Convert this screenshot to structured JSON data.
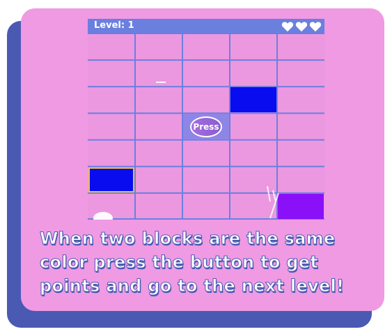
{
  "game": {
    "level_text": "Level: 1",
    "lives": 3,
    "lives_icon": "heart-icon",
    "grid": {
      "rows": 7,
      "cols": 5
    },
    "blocks": [
      {
        "row": 2,
        "col": 3,
        "color": "#0a0cf0",
        "selected": false
      },
      {
        "row": 5,
        "col": 0,
        "color": "#0a0cf0",
        "selected": true
      },
      {
        "row": 6,
        "col": 4,
        "color": "#8a10f8",
        "selected": false
      }
    ],
    "press_button": {
      "label": "Press",
      "row": 3,
      "col": 2,
      "cell_color": "#8e86e6"
    },
    "colors": {
      "board": "#eb98e1",
      "topbar": "#6b7fdf",
      "grid_line": "#6b7fdf",
      "selected_outline": "#f0c040"
    }
  },
  "instructions": "When two blocks are the same color press the button to get points and go to the next level!",
  "colors": {
    "card": "#ef9ae3",
    "card_shadow": "#4a5ab3",
    "caption_text": "#ffffff",
    "caption_outline": "#4a5ab3"
  }
}
